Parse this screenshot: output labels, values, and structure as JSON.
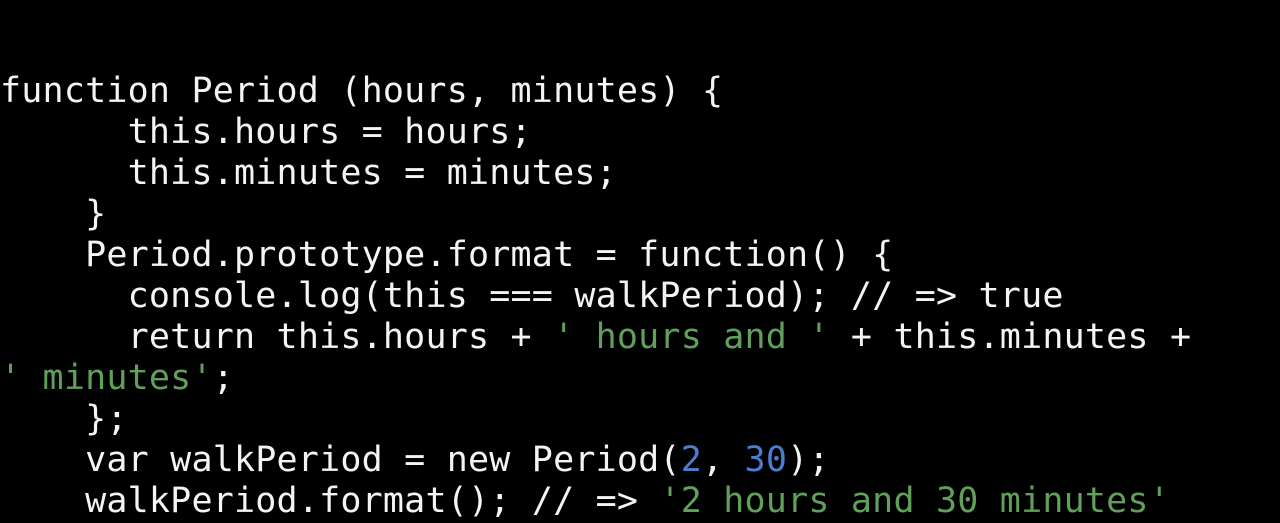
{
  "slide": {
    "background_color": "#000000",
    "language": "javascript",
    "colors": {
      "text": "#f4f4f4",
      "string": "#60a05a",
      "number": "#4a7fd0",
      "comment": "#f4f4f4"
    }
  },
  "code": {
    "lines": [
      {
        "id": "line-1",
        "indent": "",
        "tokens": [
          {
            "text": "function Period (hours, minutes) {",
            "type": "plain"
          }
        ]
      },
      {
        "id": "line-2",
        "indent": "      ",
        "tokens": [
          {
            "text": "this.hours = hours;",
            "type": "plain"
          }
        ]
      },
      {
        "id": "line-3",
        "indent": "      ",
        "tokens": [
          {
            "text": "this.minutes = minutes;",
            "type": "plain"
          }
        ]
      },
      {
        "id": "line-4",
        "indent": "    ",
        "tokens": [
          {
            "text": "}",
            "type": "plain"
          }
        ]
      },
      {
        "id": "line-5",
        "indent": "    ",
        "tokens": [
          {
            "text": "Period.prototype.format = function() {",
            "type": "plain"
          }
        ]
      },
      {
        "id": "line-6",
        "indent": "      ",
        "tokens": [
          {
            "text": "console.log(this === walkPeriod); ",
            "type": "plain"
          },
          {
            "text": "// => true",
            "type": "comment"
          }
        ]
      },
      {
        "id": "line-7",
        "indent": "      ",
        "tokens": [
          {
            "text": "return this.hours + ",
            "type": "plain"
          },
          {
            "text": "' hours and '",
            "type": "string"
          },
          {
            "text": " + this.minutes +",
            "type": "plain"
          }
        ]
      },
      {
        "id": "line-8",
        "indent": "",
        "tokens": [
          {
            "text": "' minutes'",
            "type": "string"
          },
          {
            "text": ";",
            "type": "plain"
          }
        ]
      },
      {
        "id": "line-9",
        "indent": "    ",
        "tokens": [
          {
            "text": "};",
            "type": "plain"
          }
        ]
      },
      {
        "id": "line-10",
        "indent": "    ",
        "tokens": [
          {
            "text": "var walkPeriod = new Period(",
            "type": "plain"
          },
          {
            "text": "2",
            "type": "number"
          },
          {
            "text": ", ",
            "type": "plain"
          },
          {
            "text": "30",
            "type": "number"
          },
          {
            "text": ");",
            "type": "plain"
          }
        ]
      },
      {
        "id": "line-11",
        "indent": "    ",
        "tokens": [
          {
            "text": "walkPeriod.format(); ",
            "type": "plain"
          },
          {
            "text": "// => ",
            "type": "comment"
          },
          {
            "text": "'2 hours and 30 minutes'",
            "type": "string"
          }
        ]
      }
    ]
  }
}
